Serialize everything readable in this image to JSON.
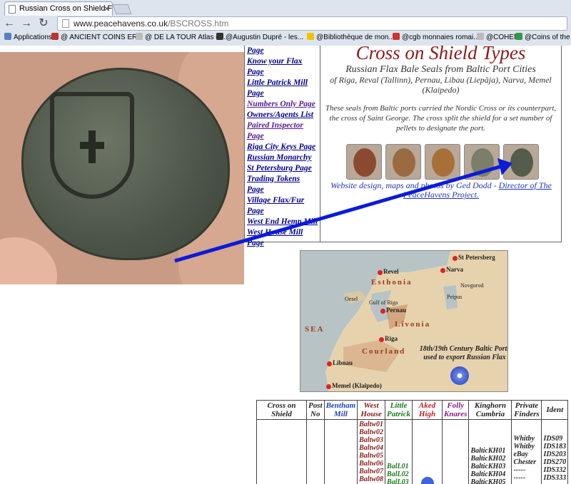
{
  "browser": {
    "tab_title": "Russian Cross on Shield Flax",
    "tab_close": "×",
    "url_domain": "www.peacehavens.co.uk",
    "url_path": "/BSCROSS.htm",
    "bookmarks": [
      {
        "label": "Applications",
        "color": "#5a7fc0"
      },
      {
        "label": "@ ANCIENT COINS ER...",
        "color": "#b33"
      },
      {
        "label": "@ DE LA TOUR Atlas d...",
        "color": "#bbb"
      },
      {
        "label": "@Augustin Dupré - les...",
        "color": "#333"
      },
      {
        "label": "@Bibliothèque de mon...",
        "color": "#f2c200"
      },
      {
        "label": "@cgb monnaies romai...",
        "color": "#c33"
      },
      {
        "label": "@COHEN",
        "color": "#bbb"
      },
      {
        "label": "@Coins of the UK",
        "color": "#394"
      }
    ]
  },
  "links": [
    {
      "label": "Page",
      "visited": false
    },
    {
      "label": "Know your Flax Page",
      "visited": false
    },
    {
      "label": "Little Patrick Mill Page",
      "visited": false
    },
    {
      "label": "Numbers Only Page",
      "visited": true
    },
    {
      "label": "Owners/Agents List",
      "visited": false
    },
    {
      "label": "Paired Inspector Page",
      "visited": true
    },
    {
      "label": "Riga City Keys Page",
      "visited": false
    },
    {
      "label": "Russian Monarchy",
      "visited": false
    },
    {
      "label": "St Petersburg Page",
      "visited": false
    },
    {
      "label": "Trading Tokens Page",
      "visited": false
    },
    {
      "label": "Village Flax/Fur Page",
      "visited": false
    },
    {
      "label": "West End Hemp Mill",
      "visited": false
    },
    {
      "label": "West House Mill Page",
      "visited": false
    }
  ],
  "info": {
    "title": "Cross on Shield Types",
    "subtitle": "Russian Flax Bale Seals from Baltic Port Cities",
    "ports": "of Riga, Reval (Tallinn), Pernau, Libau (Liepāja), Narva, Memel (Klaipedo)",
    "description": "These seals from Baltic ports carried the Nordic Cross or its counterpart, the cross of Saint George. The cross split the shield  for a set number of pellets to designate the port.",
    "seals": [
      {
        "color": "#8b4a30"
      },
      {
        "color": "#9b6a40"
      },
      {
        "color": "#a87038"
      },
      {
        "color": "#7a7e6a"
      },
      {
        "color": "#545c4c"
      }
    ],
    "credit_text": "Website design, maps and photos by Ged Dodd - ",
    "credit_link": "Director of The PeaceHavens Project."
  },
  "map": {
    "places": [
      {
        "label": "St Petersberg",
        "dot": true
      },
      {
        "label": "Narva",
        "dot": true
      },
      {
        "label": "Revel",
        "dot": true
      },
      {
        "label": "Pernau",
        "dot": true
      },
      {
        "label": "Riga",
        "dot": true
      },
      {
        "label": "Libnau",
        "dot": true
      },
      {
        "label": "Memel (Klaipedo)",
        "dot": true
      },
      {
        "label": "Oesel",
        "dot": false
      },
      {
        "label": "Gulf of Riga",
        "dot": false
      },
      {
        "label": "Peipus",
        "dot": false
      },
      {
        "label": "Novgorod",
        "dot": false
      }
    ],
    "regions": [
      "Esthonia",
      "Livonia",
      "Courland",
      "SEA"
    ],
    "note": "18th/19th Century Baltic Ports used to export Russian Flax"
  },
  "table": {
    "headers": [
      {
        "label": "Cross on Shield",
        "color": "dark"
      },
      {
        "label": "Post No",
        "color": "dark"
      },
      {
        "label": "Bentham Mill",
        "color": "blue"
      },
      {
        "label": "West House",
        "color": "red"
      },
      {
        "label": "Little Patrick",
        "color": "green"
      },
      {
        "label": "Aked High",
        "color": "bright"
      },
      {
        "label": "Folly Knares",
        "color": "mag"
      },
      {
        "label": "Kinghorn Cumbria",
        "color": "dark",
        "sub_color": "blue"
      },
      {
        "label": "Private Finders",
        "color": "dark"
      },
      {
        "label": "Ident",
        "color": "dark"
      }
    ],
    "west_house": [
      "Baltw01",
      "Baltw02",
      "Baltw03",
      "Baltw04",
      "Baltw05",
      "Baltw06",
      "Baltw07",
      "Baltw08"
    ],
    "little_patrick": [
      "BalL01",
      "BalL02",
      "BalL03"
    ],
    "kinghorn": [
      "BalticKH01",
      "BalticKH02",
      "BalticKH03",
      "BalticKH04",
      "BalticKH05"
    ],
    "private_finders": [
      "Whitby",
      "Whitby",
      "eBay",
      "Chester",
      "-----",
      "-----"
    ],
    "ident": [
      "IDS09",
      "IDS183",
      "IDS203",
      "IDS270",
      "IDS332",
      "IDS333"
    ]
  }
}
